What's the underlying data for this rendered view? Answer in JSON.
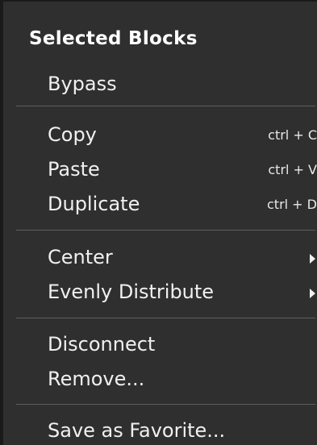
{
  "menu": {
    "header": "Selected Blocks",
    "items": [
      {
        "label": "Bypass",
        "shortcut": ""
      },
      {
        "label": "Copy",
        "shortcut": "ctrl + C"
      },
      {
        "label": "Paste",
        "shortcut": "ctrl + V"
      },
      {
        "label": "Duplicate",
        "shortcut": "ctrl + D"
      },
      {
        "label": "Center",
        "shortcut": "",
        "submenu": true
      },
      {
        "label": "Evenly Distribute",
        "shortcut": "",
        "submenu": true
      },
      {
        "label": "Disconnect",
        "shortcut": ""
      },
      {
        "label": "Remove...",
        "shortcut": ""
      },
      {
        "label": "Save as Favorite...",
        "shortcut": ""
      }
    ]
  },
  "colors": {
    "background": "#2f2f2f",
    "text": "#f0f0f0",
    "separator": "#5e5e5e"
  }
}
